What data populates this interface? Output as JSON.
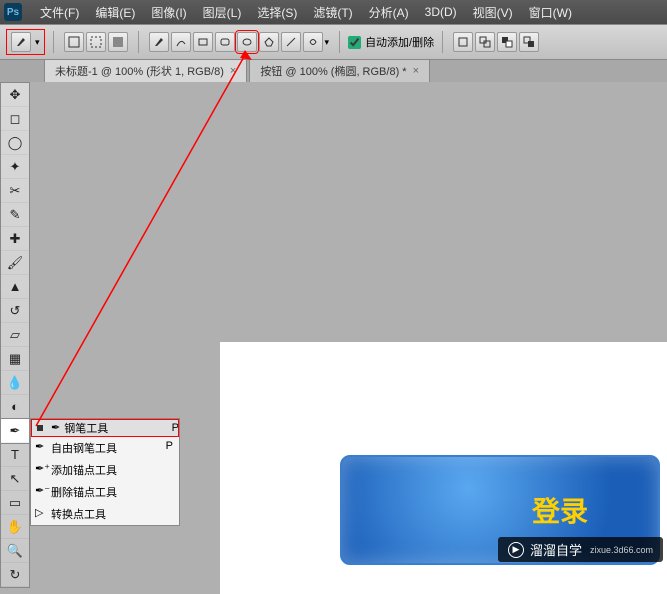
{
  "menubar": {
    "logo": "Ps",
    "items": [
      "文件(F)",
      "编辑(E)",
      "图像(I)",
      "图层(L)",
      "选择(S)",
      "滤镜(T)",
      "分析(A)",
      "3D(D)",
      "视图(V)",
      "窗口(W)"
    ]
  },
  "optbar": {
    "auto_add_delete": "自动添加/删除"
  },
  "tabs": [
    {
      "label": "未标题-1 @ 100% (形状 1, RGB/8)",
      "close": "×",
      "active": true
    },
    {
      "label": "按钮 @ 100% (椭圆, RGB/8) *",
      "close": "×",
      "active": false
    }
  ],
  "toolbox": {
    "tools": [
      "move",
      "marquee",
      "lasso",
      "wand",
      "crop",
      "eyedropper",
      "healing",
      "brush",
      "stamp",
      "history",
      "eraser",
      "gradient",
      "blur",
      "dodge",
      "pen",
      "type",
      "path",
      "shape",
      "hand",
      "zoom"
    ]
  },
  "flyout": {
    "header": {
      "label": "钢笔工具",
      "key": "P"
    },
    "items": [
      {
        "label": "自由钢笔工具",
        "key": "P"
      },
      {
        "label": "添加锚点工具",
        "key": ""
      },
      {
        "label": "删除锚点工具",
        "key": ""
      },
      {
        "label": "转换点工具",
        "key": ""
      }
    ]
  },
  "button_preview": {
    "label": "登录"
  },
  "watermark": {
    "brand": "溜溜自学",
    "url": "zixue.3d66.com"
  }
}
